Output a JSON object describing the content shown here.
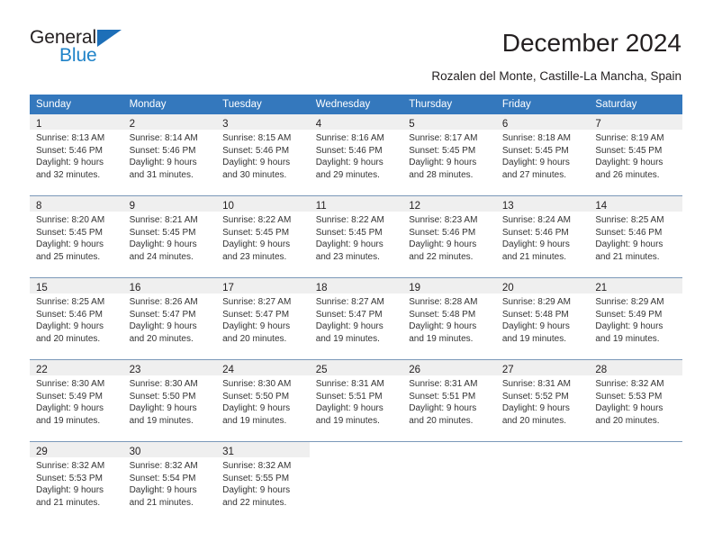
{
  "brand": {
    "name_part1": "General",
    "name_part2": "Blue",
    "triangle_color": "#1d6fb8",
    "blue_color": "#2083c8"
  },
  "header": {
    "title": "December 2024",
    "subtitle": "Rozalen del Monte, Castille-La Mancha, Spain"
  },
  "theme": {
    "header_bg": "#3478bd",
    "header_text": "#ffffff",
    "daynum_bg": "#efefef",
    "row_divider": "#7b98b9",
    "body_text": "#333333"
  },
  "weekday_headers": [
    "Sunday",
    "Monday",
    "Tuesday",
    "Wednesday",
    "Thursday",
    "Friday",
    "Saturday"
  ],
  "weeks": [
    [
      {
        "day": "1",
        "sunrise": "Sunrise: 8:13 AM",
        "sunset": "Sunset: 5:46 PM",
        "daylight_line1": "Daylight: 9 hours",
        "daylight_line2": "and 32 minutes."
      },
      {
        "day": "2",
        "sunrise": "Sunrise: 8:14 AM",
        "sunset": "Sunset: 5:46 PM",
        "daylight_line1": "Daylight: 9 hours",
        "daylight_line2": "and 31 minutes."
      },
      {
        "day": "3",
        "sunrise": "Sunrise: 8:15 AM",
        "sunset": "Sunset: 5:46 PM",
        "daylight_line1": "Daylight: 9 hours",
        "daylight_line2": "and 30 minutes."
      },
      {
        "day": "4",
        "sunrise": "Sunrise: 8:16 AM",
        "sunset": "Sunset: 5:46 PM",
        "daylight_line1": "Daylight: 9 hours",
        "daylight_line2": "and 29 minutes."
      },
      {
        "day": "5",
        "sunrise": "Sunrise: 8:17 AM",
        "sunset": "Sunset: 5:45 PM",
        "daylight_line1": "Daylight: 9 hours",
        "daylight_line2": "and 28 minutes."
      },
      {
        "day": "6",
        "sunrise": "Sunrise: 8:18 AM",
        "sunset": "Sunset: 5:45 PM",
        "daylight_line1": "Daylight: 9 hours",
        "daylight_line2": "and 27 minutes."
      },
      {
        "day": "7",
        "sunrise": "Sunrise: 8:19 AM",
        "sunset": "Sunset: 5:45 PM",
        "daylight_line1": "Daylight: 9 hours",
        "daylight_line2": "and 26 minutes."
      }
    ],
    [
      {
        "day": "8",
        "sunrise": "Sunrise: 8:20 AM",
        "sunset": "Sunset: 5:45 PM",
        "daylight_line1": "Daylight: 9 hours",
        "daylight_line2": "and 25 minutes."
      },
      {
        "day": "9",
        "sunrise": "Sunrise: 8:21 AM",
        "sunset": "Sunset: 5:45 PM",
        "daylight_line1": "Daylight: 9 hours",
        "daylight_line2": "and 24 minutes."
      },
      {
        "day": "10",
        "sunrise": "Sunrise: 8:22 AM",
        "sunset": "Sunset: 5:45 PM",
        "daylight_line1": "Daylight: 9 hours",
        "daylight_line2": "and 23 minutes."
      },
      {
        "day": "11",
        "sunrise": "Sunrise: 8:22 AM",
        "sunset": "Sunset: 5:45 PM",
        "daylight_line1": "Daylight: 9 hours",
        "daylight_line2": "and 23 minutes."
      },
      {
        "day": "12",
        "sunrise": "Sunrise: 8:23 AM",
        "sunset": "Sunset: 5:46 PM",
        "daylight_line1": "Daylight: 9 hours",
        "daylight_line2": "and 22 minutes."
      },
      {
        "day": "13",
        "sunrise": "Sunrise: 8:24 AM",
        "sunset": "Sunset: 5:46 PM",
        "daylight_line1": "Daylight: 9 hours",
        "daylight_line2": "and 21 minutes."
      },
      {
        "day": "14",
        "sunrise": "Sunrise: 8:25 AM",
        "sunset": "Sunset: 5:46 PM",
        "daylight_line1": "Daylight: 9 hours",
        "daylight_line2": "and 21 minutes."
      }
    ],
    [
      {
        "day": "15",
        "sunrise": "Sunrise: 8:25 AM",
        "sunset": "Sunset: 5:46 PM",
        "daylight_line1": "Daylight: 9 hours",
        "daylight_line2": "and 20 minutes."
      },
      {
        "day": "16",
        "sunrise": "Sunrise: 8:26 AM",
        "sunset": "Sunset: 5:47 PM",
        "daylight_line1": "Daylight: 9 hours",
        "daylight_line2": "and 20 minutes."
      },
      {
        "day": "17",
        "sunrise": "Sunrise: 8:27 AM",
        "sunset": "Sunset: 5:47 PM",
        "daylight_line1": "Daylight: 9 hours",
        "daylight_line2": "and 20 minutes."
      },
      {
        "day": "18",
        "sunrise": "Sunrise: 8:27 AM",
        "sunset": "Sunset: 5:47 PM",
        "daylight_line1": "Daylight: 9 hours",
        "daylight_line2": "and 19 minutes."
      },
      {
        "day": "19",
        "sunrise": "Sunrise: 8:28 AM",
        "sunset": "Sunset: 5:48 PM",
        "daylight_line1": "Daylight: 9 hours",
        "daylight_line2": "and 19 minutes."
      },
      {
        "day": "20",
        "sunrise": "Sunrise: 8:29 AM",
        "sunset": "Sunset: 5:48 PM",
        "daylight_line1": "Daylight: 9 hours",
        "daylight_line2": "and 19 minutes."
      },
      {
        "day": "21",
        "sunrise": "Sunrise: 8:29 AM",
        "sunset": "Sunset: 5:49 PM",
        "daylight_line1": "Daylight: 9 hours",
        "daylight_line2": "and 19 minutes."
      }
    ],
    [
      {
        "day": "22",
        "sunrise": "Sunrise: 8:30 AM",
        "sunset": "Sunset: 5:49 PM",
        "daylight_line1": "Daylight: 9 hours",
        "daylight_line2": "and 19 minutes."
      },
      {
        "day": "23",
        "sunrise": "Sunrise: 8:30 AM",
        "sunset": "Sunset: 5:50 PM",
        "daylight_line1": "Daylight: 9 hours",
        "daylight_line2": "and 19 minutes."
      },
      {
        "day": "24",
        "sunrise": "Sunrise: 8:30 AM",
        "sunset": "Sunset: 5:50 PM",
        "daylight_line1": "Daylight: 9 hours",
        "daylight_line2": "and 19 minutes."
      },
      {
        "day": "25",
        "sunrise": "Sunrise: 8:31 AM",
        "sunset": "Sunset: 5:51 PM",
        "daylight_line1": "Daylight: 9 hours",
        "daylight_line2": "and 19 minutes."
      },
      {
        "day": "26",
        "sunrise": "Sunrise: 8:31 AM",
        "sunset": "Sunset: 5:51 PM",
        "daylight_line1": "Daylight: 9 hours",
        "daylight_line2": "and 20 minutes."
      },
      {
        "day": "27",
        "sunrise": "Sunrise: 8:31 AM",
        "sunset": "Sunset: 5:52 PM",
        "daylight_line1": "Daylight: 9 hours",
        "daylight_line2": "and 20 minutes."
      },
      {
        "day": "28",
        "sunrise": "Sunrise: 8:32 AM",
        "sunset": "Sunset: 5:53 PM",
        "daylight_line1": "Daylight: 9 hours",
        "daylight_line2": "and 20 minutes."
      }
    ],
    [
      {
        "day": "29",
        "sunrise": "Sunrise: 8:32 AM",
        "sunset": "Sunset: 5:53 PM",
        "daylight_line1": "Daylight: 9 hours",
        "daylight_line2": "and 21 minutes."
      },
      {
        "day": "30",
        "sunrise": "Sunrise: 8:32 AM",
        "sunset": "Sunset: 5:54 PM",
        "daylight_line1": "Daylight: 9 hours",
        "daylight_line2": "and 21 minutes."
      },
      {
        "day": "31",
        "sunrise": "Sunrise: 8:32 AM",
        "sunset": "Sunset: 5:55 PM",
        "daylight_line1": "Daylight: 9 hours",
        "daylight_line2": "and 22 minutes."
      },
      null,
      null,
      null,
      null
    ]
  ]
}
